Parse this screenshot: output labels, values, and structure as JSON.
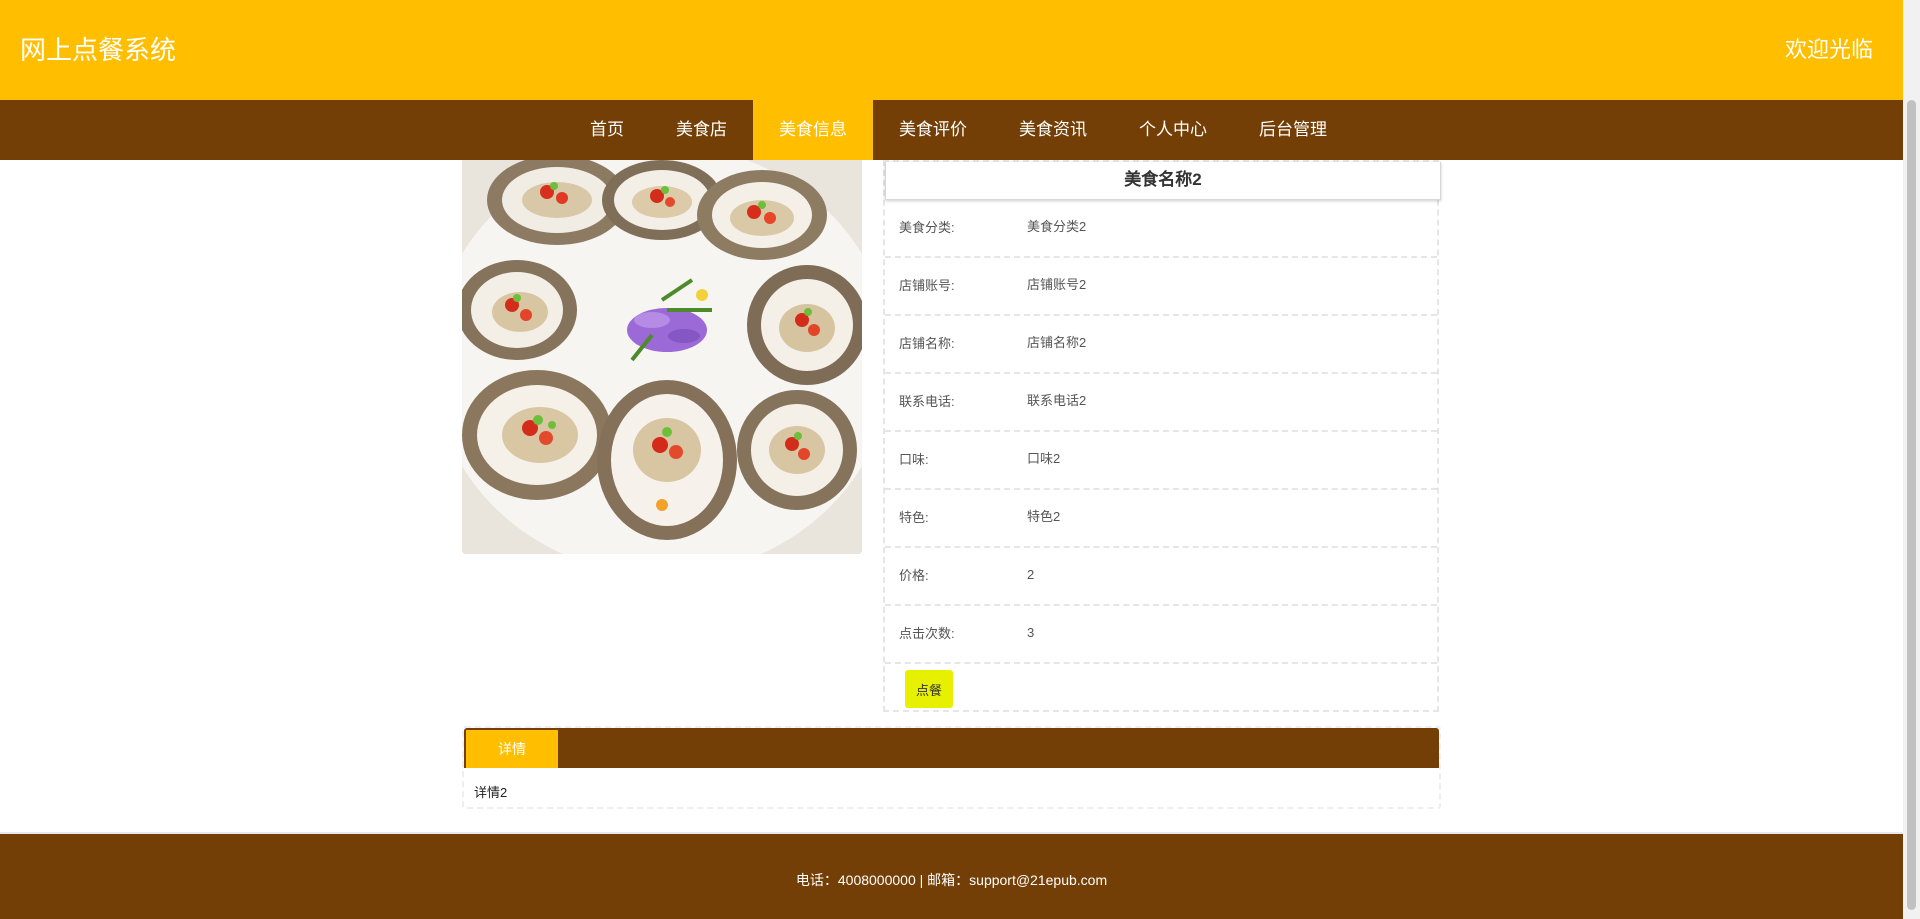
{
  "header": {
    "site_title": "网上点餐系统",
    "welcome": "欢迎光临"
  },
  "nav": {
    "items": [
      {
        "label": "首页"
      },
      {
        "label": "美食店"
      },
      {
        "label": "美食信息",
        "active": true
      },
      {
        "label": "美食评价"
      },
      {
        "label": "美食资讯"
      },
      {
        "label": "个人中心"
      },
      {
        "label": "后台管理"
      }
    ]
  },
  "food": {
    "image_alt": "food-photo-oysters",
    "name": "美食名称2",
    "fields": [
      {
        "label": "美食分类:",
        "value": "美食分类2"
      },
      {
        "label": "店铺账号:",
        "value": "店铺账号2"
      },
      {
        "label": "店铺名称:",
        "value": "店铺名称2"
      },
      {
        "label": "联系电话:",
        "value": "联系电话2"
      },
      {
        "label": "口味:",
        "value": "口味2"
      },
      {
        "label": "特色:",
        "value": "特色2"
      },
      {
        "label": "价格:",
        "value": "2"
      },
      {
        "label": "点击次数:",
        "value": "3"
      }
    ],
    "order_button": "点餐"
  },
  "details": {
    "tab_label": "详情",
    "content": "详情2"
  },
  "footer": {
    "text": "电话：4008000000 | 邮箱：support@21epub.com"
  },
  "colors": {
    "primary": "#ffbe00",
    "dark": "#743f06",
    "button": "#e6f000"
  }
}
